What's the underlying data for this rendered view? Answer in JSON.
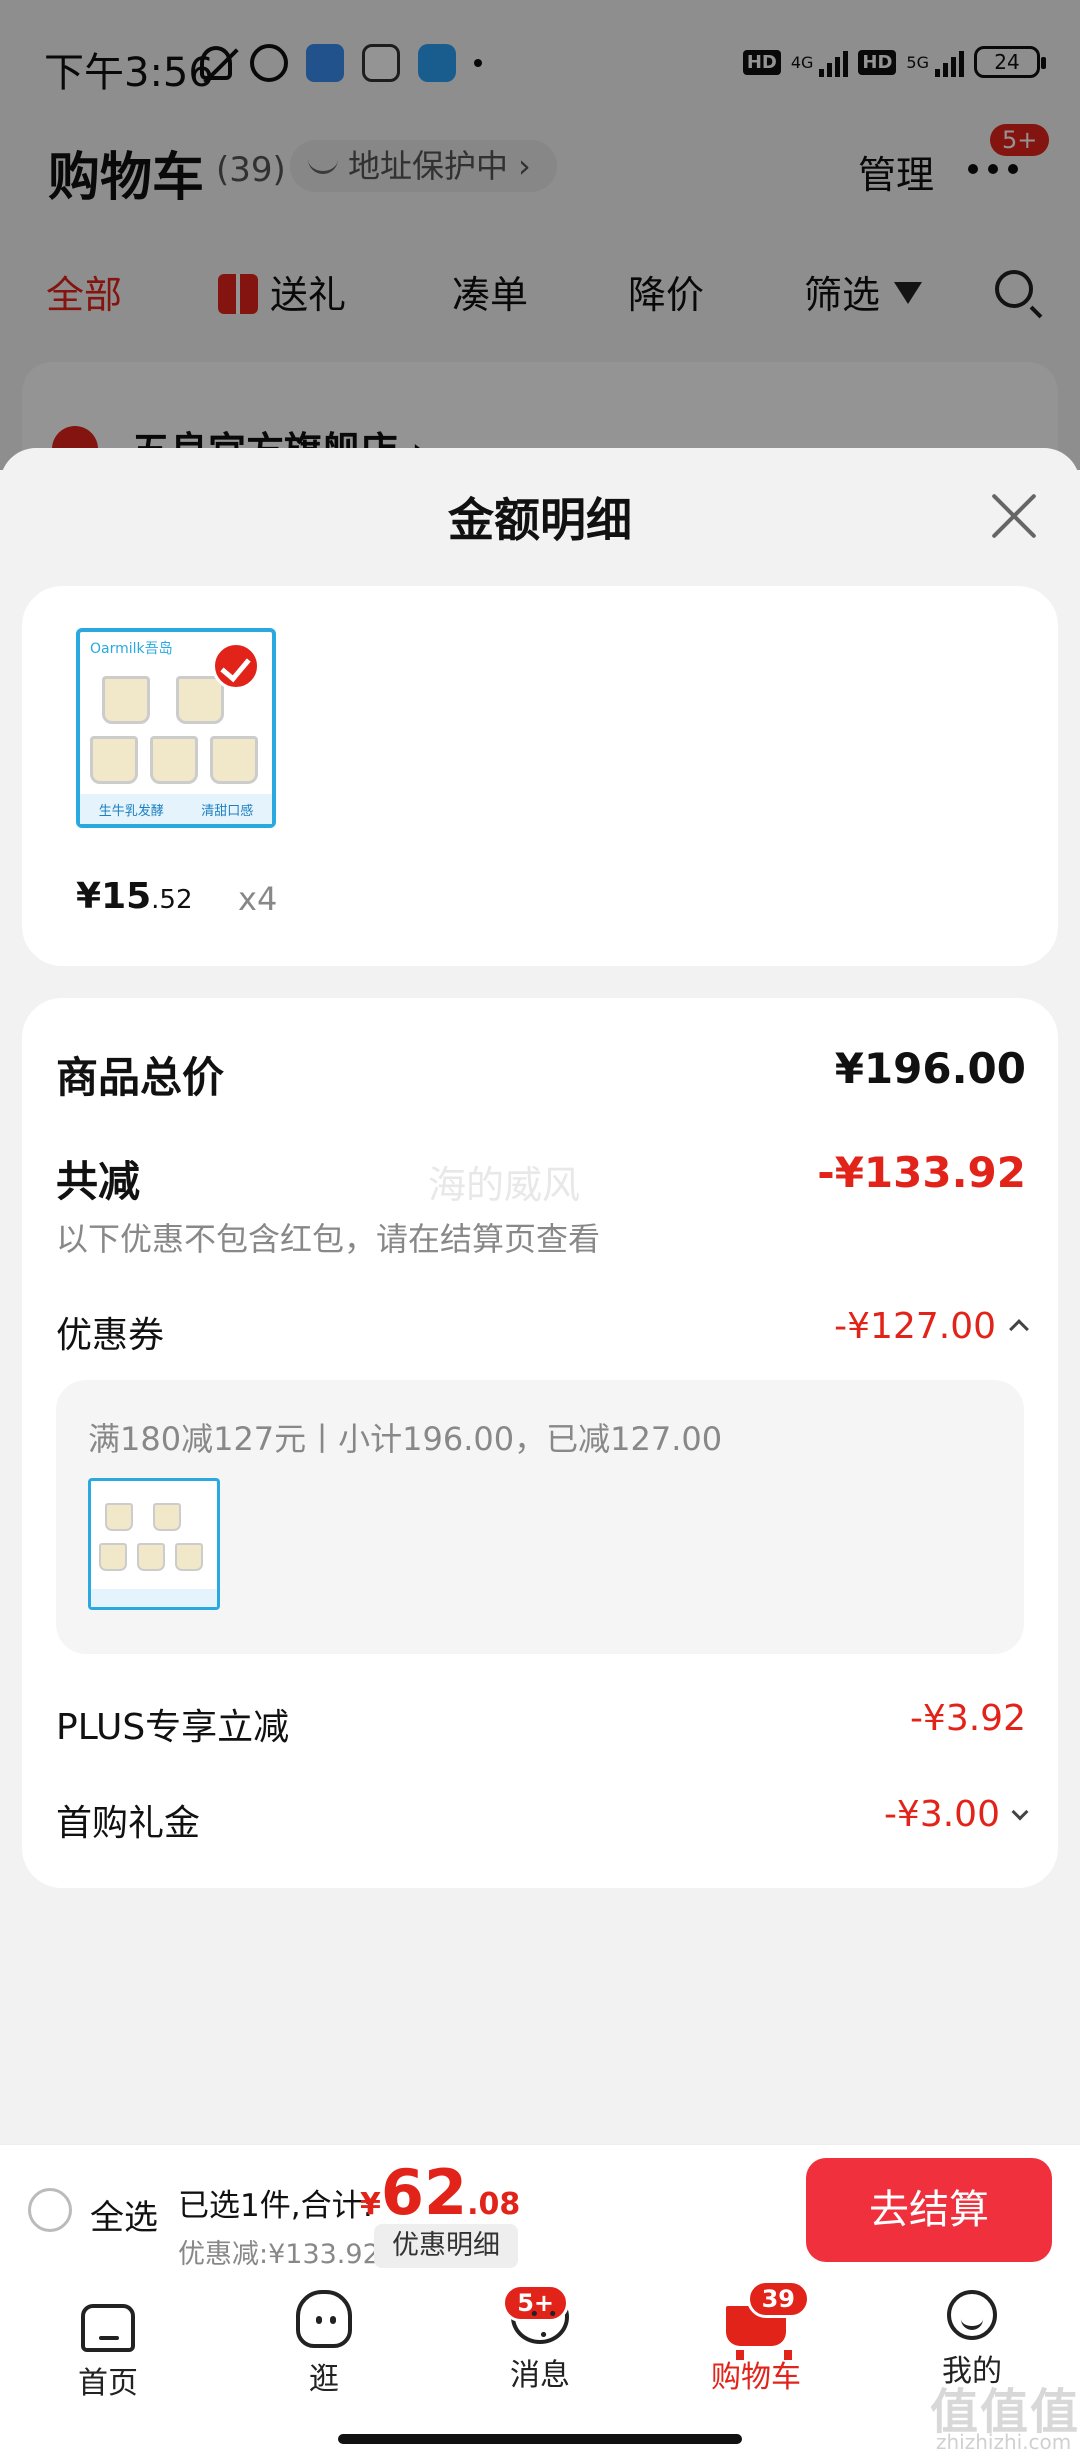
{
  "status_bar": {
    "time": "下午3:56",
    "network_left": "4G",
    "network_right": "5G",
    "hd": "HD",
    "battery": "24"
  },
  "cart_header": {
    "title": "购物车",
    "count": "(39)",
    "address_chip": "地址保护中",
    "manage": "管理",
    "more_badge": "5+"
  },
  "filter_tabs": [
    "全部",
    "送礼",
    "凑单",
    "降价",
    "筛选"
  ],
  "store": {
    "name": "五良宫方旗舰店 ›"
  },
  "sheet": {
    "title": "金额明细",
    "product": {
      "brand": "Oarmilk吾岛",
      "foot_left": "生牛乳发酵",
      "foot_right": "清甜口感",
      "price_symbol": "¥",
      "price_int": "15",
      "price_dec": ".52",
      "quantity": "x4"
    },
    "summary": {
      "total_label": "商品总价",
      "total_value": "¥196.00",
      "reduce_label": "共减",
      "reduce_value": "-¥133.92",
      "note": "以下优惠不包含红包，请在结算页查看",
      "coupon_label": "优惠券",
      "coupon_value": "-¥127.00",
      "coupon_detail": "满180减127元丨小计196.00，已减127.00",
      "plus_label": "PLUS专享立减",
      "plus_value": "-¥3.92",
      "first_label": "首购礼金",
      "first_value": "-¥3.00"
    },
    "watermark": "海的威风"
  },
  "checkout": {
    "select_all": "全选",
    "selected_text": "已选1件,合计:",
    "total_symbol": "¥",
    "total_int": "62",
    "total_dec": ".08",
    "discount_text": "优惠减:¥133.92",
    "detail_button": "优惠明细",
    "checkout_button": "去结算"
  },
  "tabbar": {
    "items": [
      {
        "label": "首页",
        "icon": "home-icon"
      },
      {
        "label": "逛",
        "icon": "face-icon"
      },
      {
        "label": "消息",
        "icon": "message-icon",
        "badge": "5+"
      },
      {
        "label": "购物车",
        "icon": "cart-icon",
        "badge": "39"
      },
      {
        "label": "我的",
        "icon": "profile-icon"
      }
    ]
  },
  "site_mark": {
    "logo": "值值值",
    "url": "zhizhizhi.com"
  },
  "colors": {
    "accent": "#e2231a",
    "checkout_button": "#f0303d",
    "thumb_border": "#29a9e0"
  }
}
